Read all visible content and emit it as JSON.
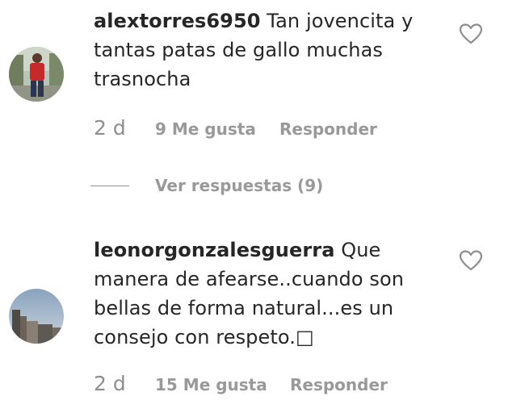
{
  "comments": [
    {
      "username": "alextorres6950",
      "text": " Tan jovencita y tantas patas de gallo muchas trasnocha",
      "time": "2 d",
      "likes": "9 Me gusta",
      "reply": "Responder",
      "view_replies": "Ver respuestas (9)"
    },
    {
      "username": "leonorgonzalesguerra",
      "text": " Que manera de afearse..cuando son bellas de forma natural...es un consejo con respeto.□",
      "time": "2 d",
      "likes": "15 Me gusta",
      "reply": "Responder"
    }
  ],
  "icons": {
    "like": "heart-outline-icon"
  },
  "colors": {
    "text": "#262626",
    "secondary": "#999999",
    "line": "#8e8e8e"
  }
}
